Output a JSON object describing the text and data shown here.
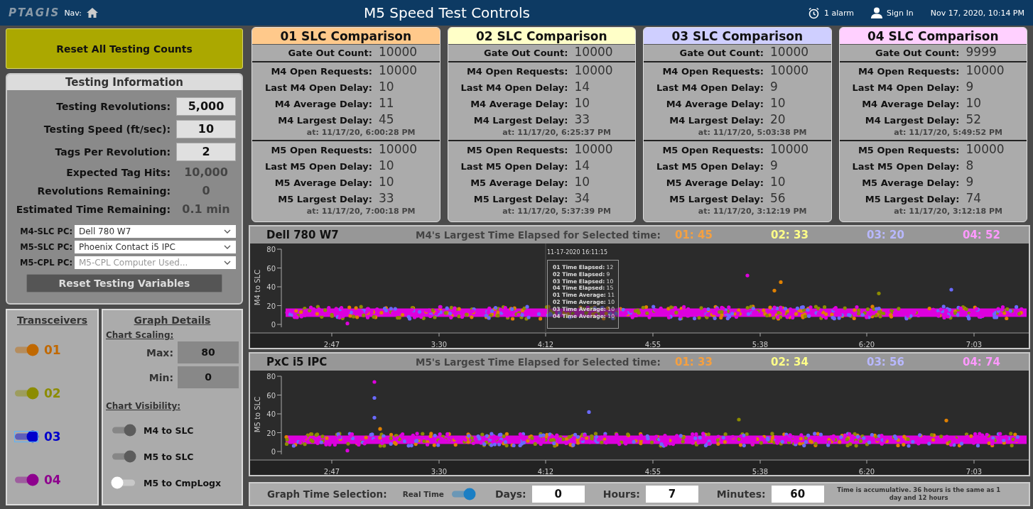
{
  "header": {
    "logo": "PTAGIS",
    "nav_label": "Nav:",
    "title": "M5 Speed Test Controls",
    "alarm": "1 alarm",
    "sign_in": "Sign In",
    "datetime": "Nov 17, 2020, 10:14 PM"
  },
  "reset_all_button": "Reset All Testing Counts",
  "testing_information": {
    "title": "Testing Information",
    "inputs": [
      {
        "label": "Testing Revolutions:",
        "value": "5,000"
      },
      {
        "label": "Testing Speed (ft/sec):",
        "value": "10"
      },
      {
        "label": "Tags Per Revolution:",
        "value": "2"
      }
    ],
    "readouts": [
      {
        "label": "Expected Tag Hits:",
        "value": "10,000"
      },
      {
        "label": "Revolutions Remaining:",
        "value": "0"
      },
      {
        "label": "Estimated Time Remaining:",
        "value": "0.1 min"
      }
    ],
    "pc_selects": [
      {
        "label": "M4-SLC PC:",
        "value": "Dell 780 W7"
      },
      {
        "label": "M5-SLC PC:",
        "value": "Phoenix Contact i5 IPC"
      },
      {
        "label": "M5-CPL PC:",
        "placeholder": "M5-CPL Computer Used..."
      }
    ],
    "reset_button": "Reset Testing Variables"
  },
  "transceivers": {
    "title": "Transceivers",
    "items": [
      {
        "label": "01",
        "color": "#c06800",
        "on": true,
        "focused": false
      },
      {
        "label": "02",
        "color": "#8c8c00",
        "on": true,
        "focused": false
      },
      {
        "label": "03",
        "color": "#0000cc",
        "on": true,
        "focused": true
      },
      {
        "label": "04",
        "color": "#8e008e",
        "on": true,
        "focused": false
      }
    ]
  },
  "graph_details": {
    "title": "Graph Details",
    "scaling_title": "Chart Scaling:",
    "scaling": [
      {
        "label": "Max:",
        "value": "80"
      },
      {
        "label": "Min:",
        "value": "0"
      }
    ],
    "visibility_title": "Chart Visibility:",
    "visibility": [
      {
        "label": "M4 to SLC",
        "on": true
      },
      {
        "label": "M5 to SLC",
        "on": true
      },
      {
        "label": "M5 to CmpLogx",
        "on": false
      }
    ]
  },
  "comparisons": [
    {
      "title": "01 SLC Comparison",
      "color": "#ffc98b",
      "gate": {
        "label": "Gate Out Count:",
        "value": "10000"
      },
      "m4": {
        "rows": [
          {
            "label": "M4 Open Requests:",
            "value": "10000"
          },
          {
            "label": "Last M4 Open Delay:",
            "value": "10"
          },
          {
            "label": "M4 Average Delay:",
            "value": "11"
          },
          {
            "label": "M4 Largest Delay:",
            "value": "45"
          }
        ],
        "at": "at: 11/17/20, 6:00:28 PM"
      },
      "m5": {
        "rows": [
          {
            "label": "M5 Open Requests:",
            "value": "10000"
          },
          {
            "label": "Last M5 Open Delay:",
            "value": "10"
          },
          {
            "label": "M5 Average Delay:",
            "value": "10"
          },
          {
            "label": "M5 Largest Delay:",
            "value": "33"
          }
        ],
        "at": "at: 11/17/20, 7:00:18 PM"
      }
    },
    {
      "title": "02 SLC Comparison",
      "color": "#ffffc8",
      "gate": {
        "label": "Gate Out Count:",
        "value": "10000"
      },
      "m4": {
        "rows": [
          {
            "label": "M4 Open Requests:",
            "value": "10000"
          },
          {
            "label": "Last M4 Open Delay:",
            "value": "14"
          },
          {
            "label": "M4 Average Delay:",
            "value": "10"
          },
          {
            "label": "M4 Largest Delay:",
            "value": "33"
          }
        ],
        "at": "at: 11/17/20, 6:25:37 PM"
      },
      "m5": {
        "rows": [
          {
            "label": "M5 Open Requests:",
            "value": "10000"
          },
          {
            "label": "Last M5 Open Delay:",
            "value": "14"
          },
          {
            "label": "M5 Average Delay:",
            "value": "10"
          },
          {
            "label": "M5 Largest Delay:",
            "value": "34"
          }
        ],
        "at": "at: 11/17/20, 5:37:39 PM"
      }
    },
    {
      "title": "03 SLC Comparison",
      "color": "#cfcfff",
      "gate": {
        "label": "Gate Out Count:",
        "value": "10000"
      },
      "m4": {
        "rows": [
          {
            "label": "M4 Open Requests:",
            "value": "10000"
          },
          {
            "label": "Last M4 Open Delay:",
            "value": "9"
          },
          {
            "label": "M4 Average Delay:",
            "value": "10"
          },
          {
            "label": "M4 Largest Delay:",
            "value": "20"
          }
        ],
        "at": "at: 11/17/20, 5:03:38 PM"
      },
      "m5": {
        "rows": [
          {
            "label": "M5 Open Requests:",
            "value": "10000"
          },
          {
            "label": "Last M5 Open Delay:",
            "value": "9"
          },
          {
            "label": "M5 Average Delay:",
            "value": "10"
          },
          {
            "label": "M5 Largest Delay:",
            "value": "56"
          }
        ],
        "at": "at: 11/17/20, 3:12:19 PM"
      }
    },
    {
      "title": "04 SLC Comparison",
      "color": "#ffd0ff",
      "gate": {
        "label": "Gate Out Count:",
        "value": "9999"
      },
      "m4": {
        "rows": [
          {
            "label": "M4 Open Requests:",
            "value": "10000"
          },
          {
            "label": "Last M4 Open Delay:",
            "value": "9"
          },
          {
            "label": "M4 Average Delay:",
            "value": "10"
          },
          {
            "label": "M4 Largest Delay:",
            "value": "52"
          }
        ],
        "at": "at: 11/17/20, 5:49:52 PM"
      },
      "m5": {
        "rows": [
          {
            "label": "M5 Open Requests:",
            "value": "10000"
          },
          {
            "label": "Last M5 Open Delay:",
            "value": "8"
          },
          {
            "label": "M5 Average Delay:",
            "value": "9"
          },
          {
            "label": "M5 Largest Delay:",
            "value": "74"
          }
        ],
        "at": "at: 11/17/20, 3:12:18 PM"
      }
    }
  ],
  "charts": [
    {
      "device": "Dell 780 W7",
      "caption": "M4's Largest Time Elapsed for Selected time:",
      "largest": [
        {
          "label": "01: 45",
          "color": "#f5a040"
        },
        {
          "label": "02: 33",
          "color": "#ffff88"
        },
        {
          "label": "03: 20",
          "color": "#b8b8ff"
        },
        {
          "label": "04: 52",
          "color": "#ff99ff"
        }
      ],
      "y_axis_label": "M4 to SLC",
      "y_ticks": [
        "80",
        "60",
        "40",
        "20",
        "0"
      ],
      "x_ticks": [
        "2:47",
        "3:30",
        "4:12",
        "4:55",
        "5:38",
        "6:20",
        "7:03"
      ],
      "tooltip": {
        "time": "11-17-2020 16:11:15",
        "lines": [
          {
            "label": "01 Time Elapsed:",
            "value": "12"
          },
          {
            "label": "02 Time Elapsed:",
            "value": "9"
          },
          {
            "label": "03 Time Elapsed:",
            "value": "10"
          },
          {
            "label": "04 Time Elapsed:",
            "value": "15"
          },
          {
            "label": "01 Time Average:",
            "value": "11"
          },
          {
            "label": "02 Time Average:",
            "value": "10"
          },
          {
            "label": "03 Time Average:",
            "value": "10"
          },
          {
            "label": "04 Time Average:",
            "value": "10"
          }
        ]
      }
    },
    {
      "device": "PxC i5 IPC",
      "caption": "M5's Largest Time Elapsed for Selected time:",
      "largest": [
        {
          "label": "01: 33",
          "color": "#f5a040"
        },
        {
          "label": "02: 34",
          "color": "#ffff88"
        },
        {
          "label": "03: 56",
          "color": "#b8b8ff"
        },
        {
          "label": "04: 74",
          "color": "#ff99ff"
        }
      ],
      "y_axis_label": "M5 to SLC",
      "y_ticks": [
        "80",
        "60",
        "40",
        "20",
        "0"
      ],
      "x_ticks": [
        "2:47",
        "3:30",
        "4:12",
        "4:55",
        "5:38",
        "6:20",
        "7:03"
      ]
    }
  ],
  "time_selection": {
    "label": "Graph Time Selection:",
    "real_time": {
      "label": "Real Time",
      "on": true
    },
    "fields": [
      {
        "label": "Days:",
        "value": "0"
      },
      {
        "label": "Hours:",
        "value": "7"
      },
      {
        "label": "Minutes:",
        "value": "60"
      }
    ],
    "note": "Time is accumulative. 36 hours is the same as 1 day and 12 hours"
  }
}
